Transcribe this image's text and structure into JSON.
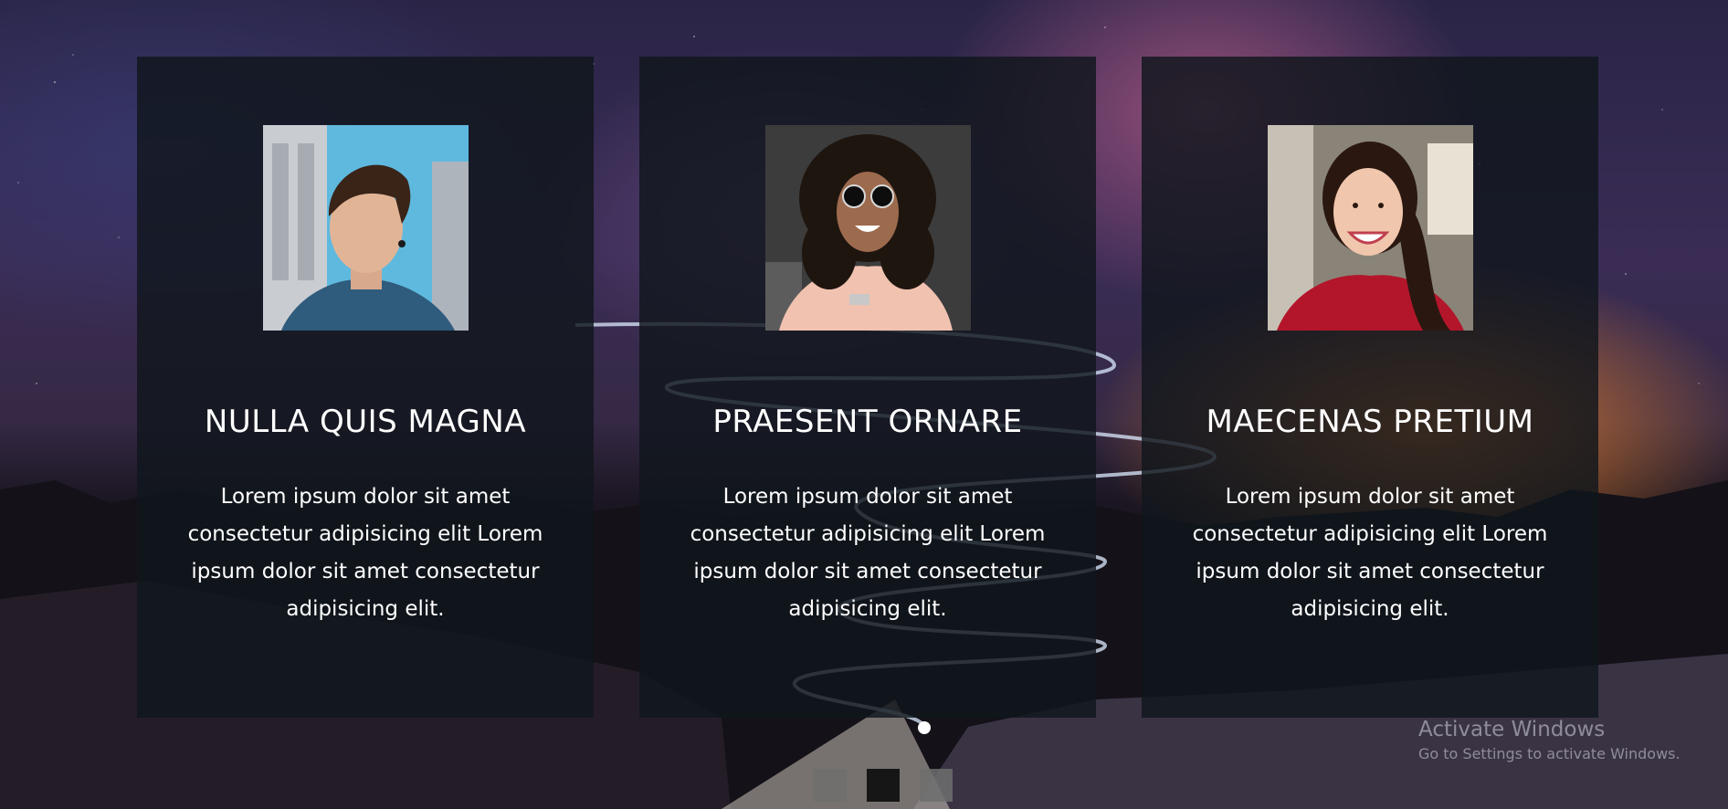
{
  "cards": [
    {
      "title": "NULLA QUIS MAGNA",
      "text": "Lorem ipsum dolor sit amet consectetur adipisicing elit Lorem ipsum dolor sit amet consectetur adipisicing elit."
    },
    {
      "title": "PRAESENT ORNARE",
      "text": "Lorem ipsum dolor sit amet consectetur adipisicing elit Lorem ipsum dolor sit amet consectetur adipisicing elit."
    },
    {
      "title": "MAECENAS PRETIUM",
      "text": "Lorem ipsum dolor sit amet consectetur adipisicing elit Lorem ipsum dolor sit amet consectetur adipisicing elit."
    }
  ],
  "pager": {
    "count": 3,
    "active_index": 1
  },
  "watermark": {
    "line1": "Activate Windows",
    "line2": "Go to Settings to activate Windows."
  },
  "colors": {
    "card_bg": "#10161c",
    "text": "#ffffff",
    "pager_dot": "#6e6e6e",
    "pager_dot_active": "#161616"
  }
}
